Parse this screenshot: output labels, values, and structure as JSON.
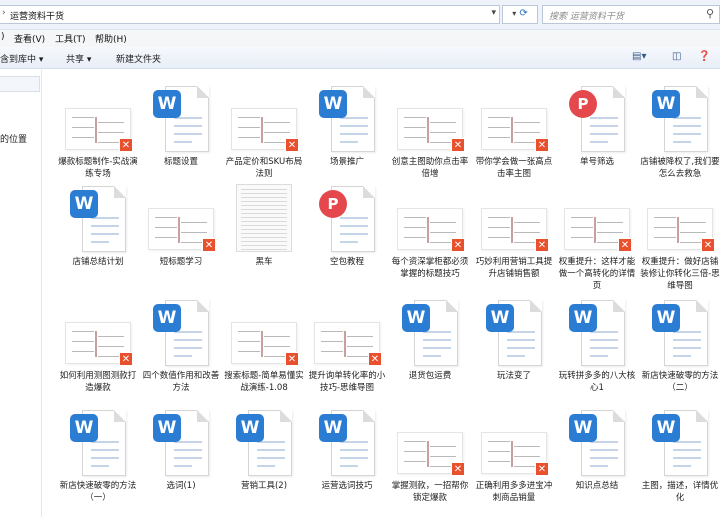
{
  "address": {
    "separator": "›",
    "path": "运营资料干货"
  },
  "search": {
    "placeholder": "搜索 运营资料干货"
  },
  "menu": [
    {
      "label": ")"
    },
    {
      "label": "查看(V)"
    },
    {
      "label": "工具(T)"
    },
    {
      "label": "帮助(H)"
    }
  ],
  "toolbar": {
    "include_label": "含到库中 ▾",
    "share_label": "共享 ▾",
    "new_folder_label": "新建文件夹"
  },
  "nav": {
    "location_label": "的位置"
  },
  "files": [
    {
      "name": "爆款标题制作-实战演练专场",
      "type": "mindmap"
    },
    {
      "name": "标题设置",
      "type": "word"
    },
    {
      "name": "产品定价和SKU布局法则",
      "type": "mindmap"
    },
    {
      "name": "场景推广",
      "type": "word"
    },
    {
      "name": "创意主图助你点击率倍增",
      "type": "mindmap"
    },
    {
      "name": "带你学会做一张高点击率主图",
      "type": "mindmap"
    },
    {
      "name": "单号筛选",
      "type": "pdf"
    },
    {
      "name": "店铺被降权了,我们要怎么去救急",
      "type": "word"
    },
    {
      "name": "店铺总结计划",
      "type": "word"
    },
    {
      "name": "短标题学习",
      "type": "mindmap"
    },
    {
      "name": "黑车",
      "type": "sheet"
    },
    {
      "name": "空包教程",
      "type": "pdf"
    },
    {
      "name": "每个资深掌柜都必须掌握的标题技巧",
      "type": "mindmap"
    },
    {
      "name": "巧妙利用营销工具提升店铺销售额",
      "type": "mindmap"
    },
    {
      "name": "权重提升：这样才能做一个高转化的详情页",
      "type": "mindmap"
    },
    {
      "name": "权重提升：做好店铺装修让你转化三倍-思维导图",
      "type": "mindmap"
    },
    {
      "name": "如何利用测图测款打造爆款",
      "type": "mindmap"
    },
    {
      "name": "四个数值作用和改善方法",
      "type": "word"
    },
    {
      "name": "搜索标题-简单易懂实战演练-1.08",
      "type": "mindmap"
    },
    {
      "name": "提升询单转化率的小技巧-思维导图",
      "type": "mindmap"
    },
    {
      "name": "退货包运费",
      "type": "word"
    },
    {
      "name": "玩法变了",
      "type": "word"
    },
    {
      "name": "玩转拼多多的八大核心1",
      "type": "word"
    },
    {
      "name": "新店快速破零的方法（二）",
      "type": "word"
    },
    {
      "name": "新店快速破零的方法（一）",
      "type": "word"
    },
    {
      "name": "选词(1)",
      "type": "word"
    },
    {
      "name": "营销工具(2)",
      "type": "word"
    },
    {
      "name": "运营选词技巧",
      "type": "word"
    },
    {
      "name": "掌握测款，一招帮你锁定爆款",
      "type": "mindmap"
    },
    {
      "name": "正确利用多多进宝冲刺商品销量",
      "type": "mindmap"
    },
    {
      "name": "知识点总结",
      "type": "word"
    },
    {
      "name": "主图，描述，详情优化",
      "type": "word"
    }
  ]
}
